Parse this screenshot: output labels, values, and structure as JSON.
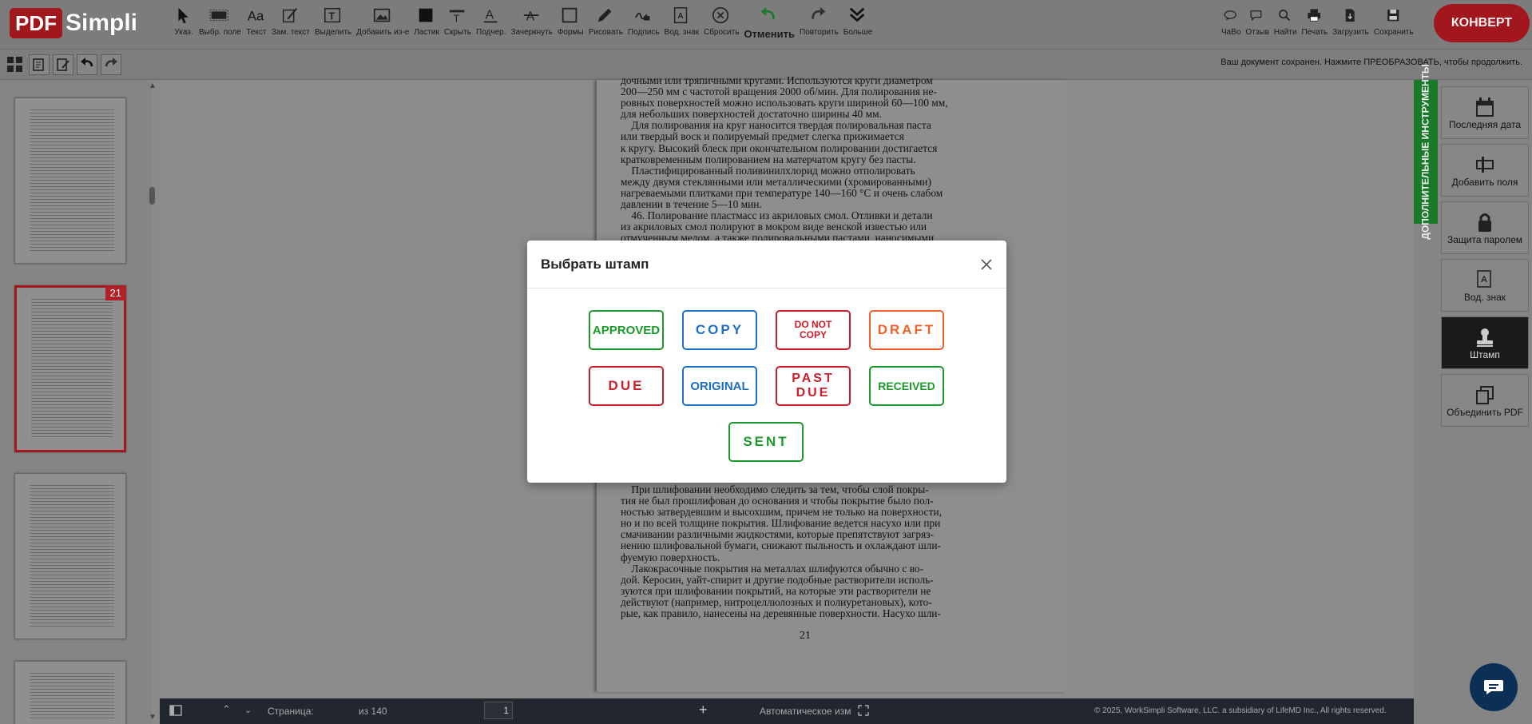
{
  "logo": {
    "part1": "PDF",
    "part2": "Simpli"
  },
  "toolbar": {
    "tools": [
      {
        "label": "Указ.",
        "icon": "pointer-icon"
      },
      {
        "label": "Выбр. поле",
        "icon": "select-field-icon"
      },
      {
        "label": "Текст",
        "icon": "text-icon"
      },
      {
        "label": "Зам. текст",
        "icon": "replace-text-icon"
      },
      {
        "label": "Выделить",
        "icon": "highlight-icon"
      },
      {
        "label": "Добавить из-е",
        "icon": "add-image-icon"
      },
      {
        "label": "Ластик",
        "icon": "eraser-icon"
      },
      {
        "label": "Скрыть",
        "icon": "hide-icon"
      },
      {
        "label": "Подчер.",
        "icon": "underline-icon"
      },
      {
        "label": "Зачеркнуть",
        "icon": "strikethrough-icon"
      },
      {
        "label": "Формы",
        "icon": "shapes-icon"
      },
      {
        "label": "Рисовать",
        "icon": "draw-icon"
      },
      {
        "label": "Подпись",
        "icon": "signature-icon"
      },
      {
        "label": "Вод. знак",
        "icon": "watermark-icon"
      },
      {
        "label": "Сбросить",
        "icon": "reset-icon"
      },
      {
        "label": "Отменить",
        "icon": "undo-icon"
      },
      {
        "label": "Повторить",
        "icon": "redo-icon"
      },
      {
        "label": "Больше",
        "icon": "more-icon"
      }
    ],
    "right_tools": [
      {
        "label": "ЧаВо",
        "icon": "faq-icon"
      },
      {
        "label": "Отзыв",
        "icon": "feedback-icon"
      },
      {
        "label": "Найти",
        "icon": "search-icon"
      },
      {
        "label": "Печать",
        "icon": "print-icon"
      },
      {
        "label": "Загрузить",
        "icon": "download-icon"
      },
      {
        "label": "Сохранить",
        "icon": "save-icon"
      }
    ],
    "convert_label": "КОНВЕРТ"
  },
  "status": {
    "saved_message": "Ваш документ сохранен. Нажмите ПРЕОБРАЗОВАТЬ, чтобы продолжить."
  },
  "thumbnails": {
    "active_page_badge": "21"
  },
  "document": {
    "top_lines": [
      "дочными или тряпичными кругами. Используются круги диаметром",
      "200—250 мм с частотой вращения 2000 об/мин. Для полирования не-",
      "ровных поверхностей можно использовать круги шириной 60—100 мм,",
      "для небольших поверхностей достаточно ширины 40 мм.",
      "    Для полирования на круг наносится твердая полировальная паста",
      "или твердый воск и полируемый предмет слегка прижимается",
      "к кругу. Высокий блеск при окончательном полировании достигается",
      "кратковременным полированием на матерчатом кругу без пасты.",
      "    Пластифицированный поливинилхлорид можно отполировать",
      "между двумя стеклянными или металлическими (хромированными)",
      "нагреваемыми плитками при температуре 140—160 °C и очень слабом",
      "давлении в течение 5—10 мин.",
      "    46. Полирование пластмасс из акриловых смол. Отливки и детали",
      "из акриловых смол полируют в мокром виде венской известью или",
      "отмученным мелом, а также полировальными пастами, наносимыми"
    ],
    "bottom_lines": [
      "    При шлифовании необходимо следить за тем, чтобы слой покры-",
      "тия не был прошлифован до основания и чтобы покрытие было пол-",
      "ностью затвердевшим и высохшим, причем не только на поверхности,",
      "но и по всей толщине покрытия. Шлифование ведется насухо или при",
      "смачивании различными жидкостями, которые препятствуют загряз-",
      "нению шлифовальной бумаги, снижают пыльность и охлаждают шли-",
      "фуемую поверхность.",
      "    Лакокрасочные покрытия на металлах шлифуются обычно с во-",
      "дой. Керосин, уайт-спирит и другие подобные растворители исполь-",
      "зуются при шлифовании покрытий, на которые эти растворители не",
      "действуют (например, нитроцеллюлозных и полиуретановых), кото-",
      "рые, как правило, нанесены на деревянные поверхности. Насухо шли-"
    ],
    "page_number": "21"
  },
  "right_panel": {
    "extra_tools_label": "ДОПОЛНИТЕЛЬНЫЕ ИНСТРУМЕНТЫ",
    "buttons": [
      {
        "label": "Последняя дата",
        "icon": "calendar-icon"
      },
      {
        "label": "Добавить поля",
        "icon": "add-field-icon"
      },
      {
        "label": "Защита паролем",
        "icon": "lock-icon"
      },
      {
        "label": "Вод. знак",
        "icon": "watermark-icon"
      },
      {
        "label": "Штамп",
        "icon": "stamp-icon"
      },
      {
        "label": "Объединить PDF",
        "icon": "merge-icon"
      }
    ]
  },
  "footer": {
    "page_label": "Страница:",
    "page_value": "1",
    "page_of": "из 140",
    "zoom_mode": "Автоматическое изм",
    "copyright": "© 2025, WorkSimpli Software, LLC. a subsidiary of LifeMD Inc., All rights reserved."
  },
  "modal": {
    "title": "Выбрать штамп",
    "stamps": [
      {
        "label": "APPROVED",
        "color": "#1a9a2a"
      },
      {
        "label": "COPY",
        "color": "#1e6fc4"
      },
      {
        "label": "DO NOT COPY",
        "color": "#d01c28"
      },
      {
        "label": "DRAFT",
        "color": "#f0602a"
      },
      {
        "label": "DUE",
        "color": "#d01c28"
      },
      {
        "label": "ORIGINAL",
        "color": "#1e6fc4"
      },
      {
        "label": "PAST DUE",
        "color": "#d01c28"
      },
      {
        "label": "RECEIVED",
        "color": "#1a9a2a"
      },
      {
        "label": "SENT",
        "color": "#1a9a2a"
      }
    ]
  }
}
